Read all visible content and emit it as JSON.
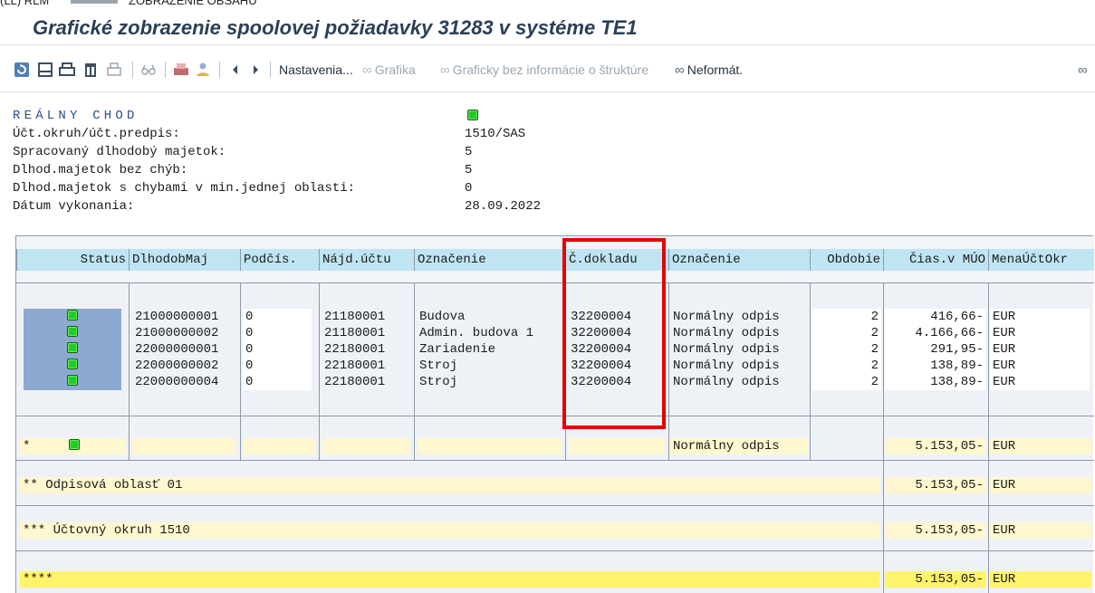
{
  "top_strip": {
    "left_text": "(LL) RLM",
    "right_text": "ZOBRAZENIE OBSAHU"
  },
  "title": "Grafické zobrazenie spoolovej požiadavky 31283 v systéme TE1",
  "toolbar": {
    "icons": [
      "refresh-icon",
      "print-icon",
      "print-immediately-icon",
      "delete-icon",
      "printer-settings-icon",
      "display-icon",
      "fax-icon",
      "user-icon",
      "prev-page-icon",
      "next-page-icon"
    ],
    "settings_label": "Nastavenia...",
    "graphic_label": "Grafika",
    "graphic_nostruct_label": "Graficky bez informácie o štruktúre",
    "unformatted_label": "Neformát."
  },
  "header": {
    "heading": "REÁLNY CHOD",
    "lines": [
      {
        "label": "Účt.okruh/účt.predpis:",
        "value": "1510/SAS"
      },
      {
        "label": "Spracovaný dlhodobý majetok:",
        "value": "5"
      },
      {
        "label": "Dlhod.majetok bez chýb:",
        "value": "5"
      },
      {
        "label": "Dlhod.majetok s chybami v min.jednej oblasti:",
        "value": "0"
      },
      {
        "label": "Dátum vykonania:",
        "value": "28.09.2022"
      }
    ]
  },
  "table": {
    "columns": [
      "Status",
      "DlhodobMaj",
      "Podčís.",
      "Nájd.účtu",
      "Označenie",
      "Č.dokladu",
      "Označenie",
      "Obdobie",
      "Čias.v MÚO",
      "MenaÚčtOkr"
    ],
    "rows": [
      {
        "asset": "21000000001",
        "sub": "0",
        "account": "21180001",
        "desc": "Budova",
        "doc": "32200004",
        "dep": "Normálny odpis",
        "period": "2",
        "amount": "416,66-",
        "cur": "EUR"
      },
      {
        "asset": "21000000002",
        "sub": "0",
        "account": "21180001",
        "desc": "Admin. budova 1",
        "doc": "32200004",
        "dep": "Normálny odpis",
        "period": "2",
        "amount": "4.166,66-",
        "cur": "EUR"
      },
      {
        "asset": "22000000001",
        "sub": "0",
        "account": "22180001",
        "desc": "Zariadenie",
        "doc": "32200004",
        "dep": "Normálny odpis",
        "period": "2",
        "amount": "291,95-",
        "cur": "EUR"
      },
      {
        "asset": "22000000002",
        "sub": "0",
        "account": "22180001",
        "desc": "Stroj",
        "doc": "32200004",
        "dep": "Normálny odpis",
        "period": "2",
        "amount": "138,89-",
        "cur": "EUR"
      },
      {
        "asset": "22000000004",
        "sub": "0",
        "account": "22180001",
        "desc": "Stroj",
        "doc": "32200004",
        "dep": "Normálny odpis",
        "period": "2",
        "amount": "138,89-",
        "cur": "EUR"
      }
    ],
    "subtotal": {
      "marker": "*",
      "dep": "Normálny odpis",
      "amount": "5.153,05-",
      "cur": "EUR"
    },
    "totals": [
      {
        "label": "**  Odpisová oblasť 01",
        "amount": "5.153,05-",
        "cur": "EUR"
      },
      {
        "label": "*** Účtovný okruh 1510",
        "amount": "5.153,05-",
        "cur": "EUR"
      },
      {
        "label": "****",
        "amount": "5.153,05-",
        "cur": "EUR"
      }
    ]
  },
  "colors": {
    "status_green": "#22cc22",
    "header_cell": "#bfe5f2",
    "highlight_red": "#e60000",
    "total_yellow": "#fff36a"
  }
}
